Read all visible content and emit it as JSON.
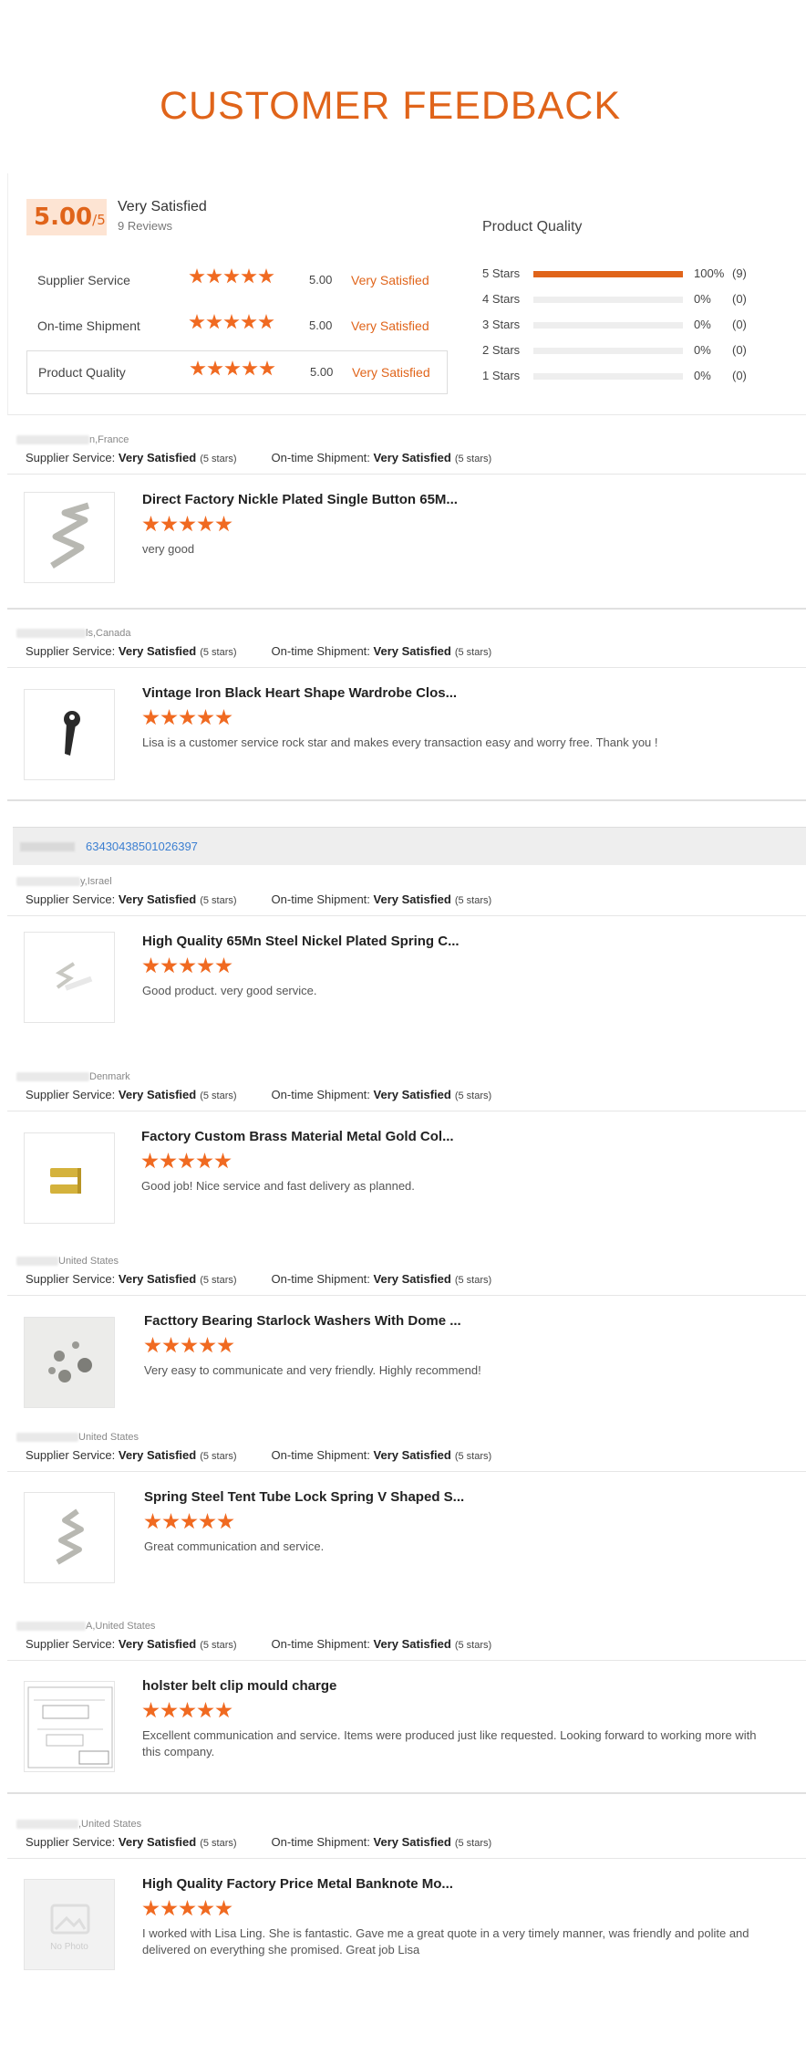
{
  "title": "CUSTOMER FEEDBACK",
  "summary": {
    "score": "5.00",
    "score_suffix": "/5",
    "label": "Very Satisfied",
    "reviews_count": "9 Reviews",
    "rows": [
      {
        "label": "Supplier Service",
        "score": "5.00",
        "text": "Very Satisfied"
      },
      {
        "label": "On-time Shipment",
        "score": "5.00",
        "text": "Very Satisfied"
      },
      {
        "label": "Product Quality",
        "score": "5.00",
        "text": "Very Satisfied"
      }
    ],
    "quality_title": "Product Quality",
    "distribution": [
      {
        "label": "5 Stars",
        "percent": 100,
        "pct_text": "100%",
        "count": "(9)"
      },
      {
        "label": "4 Stars",
        "percent": 0,
        "pct_text": "0%",
        "count": "(0)"
      },
      {
        "label": "3 Stars",
        "percent": 0,
        "pct_text": "0%",
        "count": "(0)"
      },
      {
        "label": "2 Stars",
        "percent": 0,
        "pct_text": "0%",
        "count": "(0)"
      },
      {
        "label": "1 Stars",
        "percent": 0,
        "pct_text": "0%",
        "count": "(0)"
      }
    ]
  },
  "labels": {
    "supplier_service": "Supplier Service:",
    "ontime_shipment": "On-time Shipment:",
    "very_satisfied": "Very Satisfied",
    "five_stars": "(5 stars)"
  },
  "order_number": "63430438501026397",
  "reviews": [
    {
      "buyer": "n,France",
      "title": "Direct Factory Nickle Plated Single Button 65M...",
      "comment": "very good",
      "stars": 5,
      "image": "spring-clip-icon"
    },
    {
      "buyer": "ls,Canada",
      "title": "Vintage Iron Black Heart Shape Wardrobe Clos...",
      "comment": "Lisa is a customer service rock star and makes every transaction easy and worry free. Thank you !",
      "stars": 5,
      "image": "black-hook-icon"
    },
    {
      "buyer": "y,Israel",
      "title": "High Quality 65Mn Steel Nickel Plated Spring C...",
      "comment": "Good product. very good service.",
      "stars": 5,
      "image": "small-spring-clip-icon"
    },
    {
      "buyer": "Denmark",
      "title": "Factory Custom Brass Material Metal Gold Col...",
      "comment": "Good job! Nice service and fast delivery as planned.",
      "stars": 5,
      "image": "brass-clips-icon"
    },
    {
      "buyer": "United States",
      "title": "Facttory Bearing Starlock Washers With Dome ...",
      "comment": "Very easy to communicate and very friendly. Highly recommend!",
      "stars": 5,
      "image": "washers-icon"
    },
    {
      "buyer": "United States",
      "title": "Spring Steel Tent Tube Lock Spring V Shaped S...",
      "comment": "Great communication and service.",
      "stars": 5,
      "image": "v-spring-icon"
    },
    {
      "buyer": "A,United States",
      "title": "holster belt clip mould charge",
      "comment": "Excellent communication and service. Items were produced just like requested. Looking forward to working more with this company.",
      "stars": 5,
      "image": "drawing-icon"
    },
    {
      "buyer": ",United States",
      "title": "High Quality Factory Price Metal Banknote Mo...",
      "comment": "I worked with Lisa Ling.  She is fantastic.  Gave me a great quote in a very timely manner, was friendly and polite and delivered on everything she promised.  Great job Lisa",
      "stars": 5,
      "image": "no-photo-icon",
      "no_photo": "No Photo"
    }
  ]
}
